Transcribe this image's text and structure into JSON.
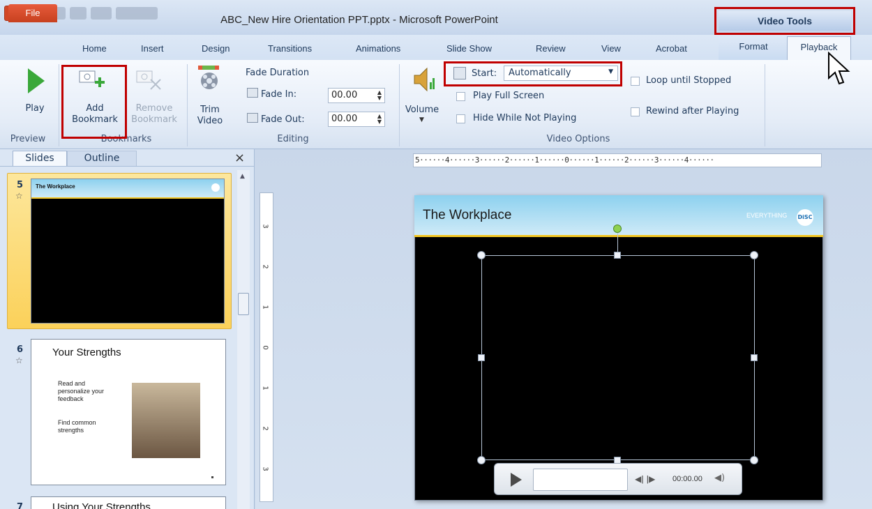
{
  "window": {
    "title": "ABC_New Hire Orientation PPT.pptx  -  Microsoft PowerPoint",
    "app_icon_letter": "P",
    "contextual_tab_group": "Video Tools"
  },
  "tabs": {
    "file": "File",
    "home": "Home",
    "insert": "Insert",
    "design": "Design",
    "transitions": "Transitions",
    "animations": "Animations",
    "slide_show": "Slide Show",
    "review": "Review",
    "view": "View",
    "acrobat": "Acrobat",
    "format": "Format",
    "playback": "Playback"
  },
  "ribbon": {
    "preview": {
      "group_label": "Preview",
      "play_label": "Play"
    },
    "bookmarks": {
      "group_label": "Bookmarks",
      "add_line1": "Add",
      "add_line2": "Bookmark",
      "remove_line1": "Remove",
      "remove_line2": "Bookmark"
    },
    "editing": {
      "group_label": "Editing",
      "trim_line1": "Trim",
      "trim_line2": "Video",
      "fade_duration_label": "Fade Duration",
      "fade_in_label": "Fade In:",
      "fade_in_value": "00.00",
      "fade_out_label": "Fade Out:",
      "fade_out_value": "00.00"
    },
    "video_options": {
      "group_label": "Video Options",
      "volume_label": "Volume",
      "start_label": "Start:",
      "start_value": "Automatically",
      "play_full_screen": "Play Full Screen",
      "hide_while_not_playing": "Hide While Not Playing",
      "loop_until_stopped": "Loop until Stopped",
      "rewind_after_playing": "Rewind after Playing"
    }
  },
  "left_pane": {
    "tab_slides": "Slides",
    "tab_outline": "Outline",
    "close_glyph": "×",
    "slides": [
      {
        "number": "5",
        "title": "The Workplace"
      },
      {
        "number": "6",
        "title": "Your Strengths",
        "bullet1": "Read and personalize your feedback",
        "bullet2": "Find common strengths"
      },
      {
        "number": "7",
        "title": "Using Your Strengths"
      }
    ]
  },
  "ruler": {
    "horizontal": "5······4······3······2······1······0······1······2······3······4······",
    "vertical": [
      "3",
      "2",
      "1",
      "0",
      "1",
      "2",
      "3"
    ]
  },
  "slide": {
    "title": "The Workplace",
    "logo_text": "EVERYTHING",
    "logo_badge": "DiSC"
  },
  "player": {
    "time": "00:00.00"
  }
}
